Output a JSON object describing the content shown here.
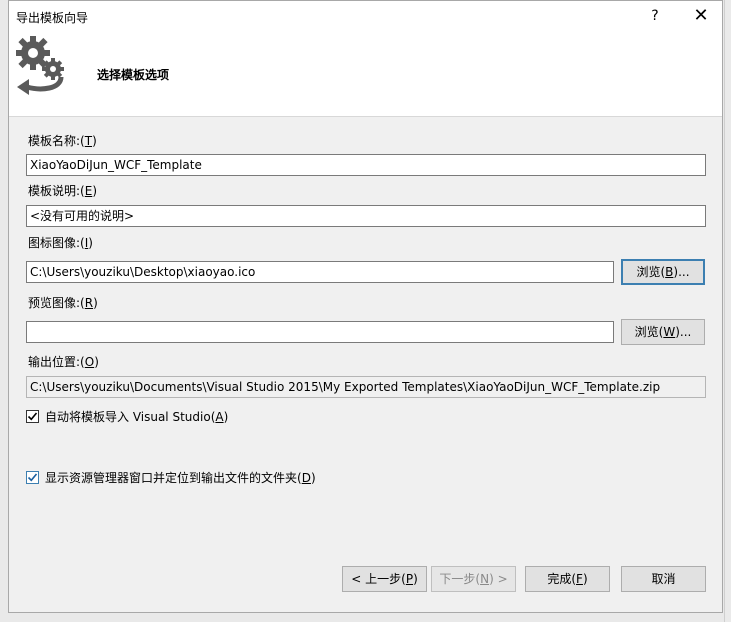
{
  "window": {
    "title": "导出模板向导",
    "help": "?",
    "close": "✕"
  },
  "header": {
    "title": "选择模板选项",
    "icon": "gears-arrow-icon"
  },
  "form": {
    "name": {
      "label": "模板名称:",
      "hotkey": "T",
      "value": "XiaoYaoDiJun_WCF_Template"
    },
    "description": {
      "label": "模板说明:",
      "hotkey": "E",
      "value": "<没有可用的说明>"
    },
    "icon_image": {
      "label": "图标图像:",
      "hotkey": "I",
      "value": "C:\\Users\\youziku\\Desktop\\xiaoyao.ico",
      "browse": "浏览",
      "browse_hotkey": "B"
    },
    "preview_image": {
      "label": "预览图像:",
      "hotkey": "R",
      "value": "",
      "browse": "浏览",
      "browse_hotkey": "W"
    },
    "output": {
      "label": "输出位置:",
      "hotkey": "O",
      "value": "C:\\Users\\youziku\\Documents\\Visual Studio 2015\\My Exported Templates\\XiaoYaoDiJun_WCF_Template.zip"
    },
    "auto_import": {
      "label": "自动将模板导入 Visual Studio",
      "hotkey": "A",
      "checked": true
    },
    "show_explorer": {
      "label": "显示资源管理器窗口并定位到输出文件的文件夹",
      "hotkey": "D",
      "checked": true
    }
  },
  "footer": {
    "prev": {
      "label": "< 上一步",
      "hotkey": "P"
    },
    "next": {
      "label": "下一步",
      "hotkey": "N",
      "suffix": " >"
    },
    "finish": {
      "label": "完成",
      "hotkey": "F"
    },
    "cancel": {
      "label": "取消"
    }
  },
  "colors": {
    "accent": "#3c7fb1",
    "gear": "#5a5a5a"
  }
}
